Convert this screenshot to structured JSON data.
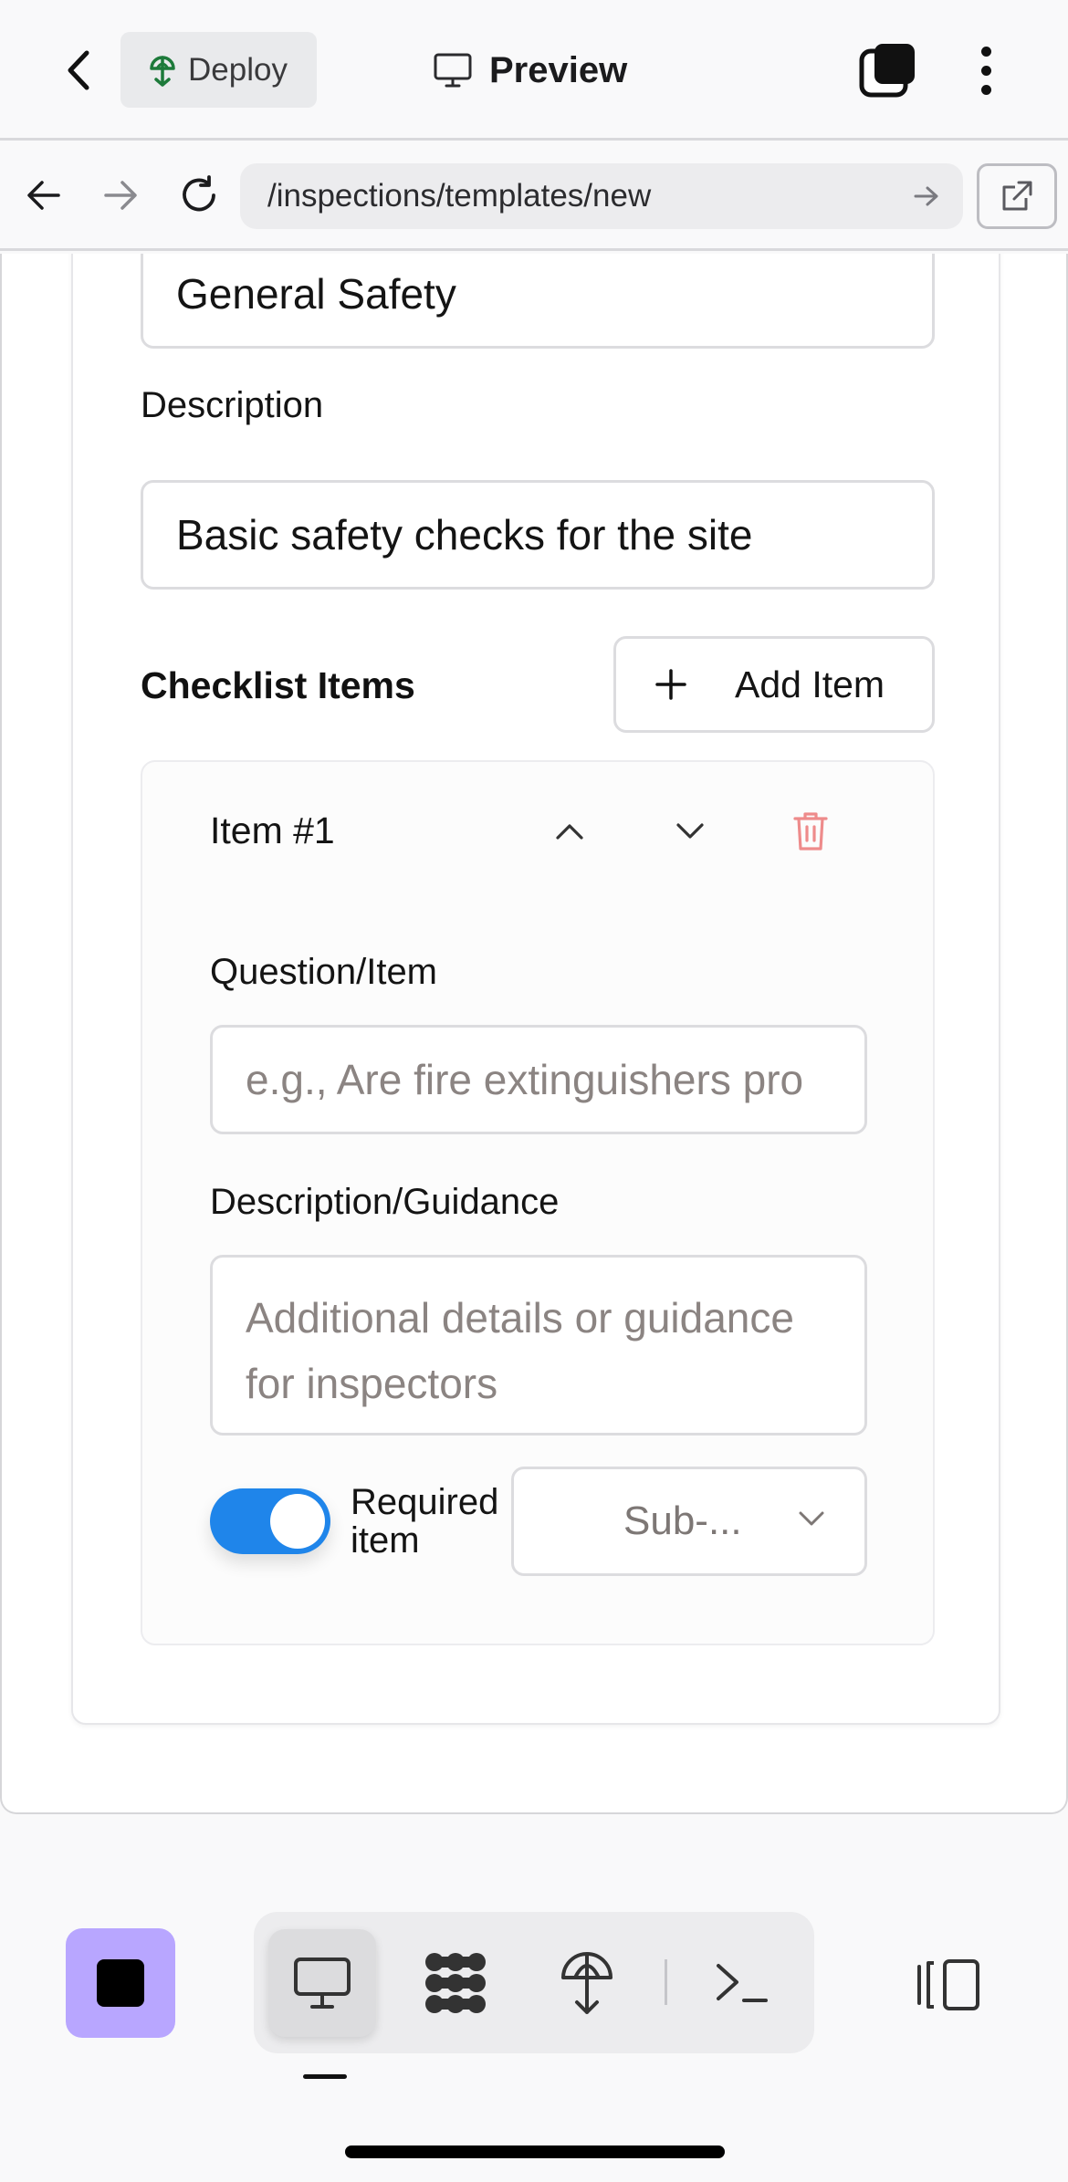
{
  "header": {
    "deploy_label": "Deploy",
    "preview_label": "Preview"
  },
  "urlbar": {
    "url": "/inspections/templates/new"
  },
  "form": {
    "name_value": "General Safety",
    "description_label": "Description",
    "description_value": "Basic safety checks for the site",
    "checklist_title": "Checklist Items",
    "add_item_label": "Add Item",
    "item": {
      "title": "Item #1",
      "question_label": "Question/Item",
      "question_placeholder": "e.g., Are fire extinguishers pro",
      "guidance_label": "Description/Guidance",
      "guidance_placeholder": "Additional details or guidance for inspectors",
      "required_on": true,
      "required_label_line1": "Required",
      "required_label_line2": "item",
      "select_value": "Sub-..."
    }
  },
  "colors": {
    "toggle_on": "#1f85ea",
    "delete_icon": "#ee8b8b",
    "accent_dock": "#b8a6ff",
    "deploy_icon": "#1d7a3a"
  },
  "dock": {
    "icons": [
      "monitor-icon",
      "apps-grid-icon",
      "deploy-icon",
      "terminal-icon"
    ]
  }
}
